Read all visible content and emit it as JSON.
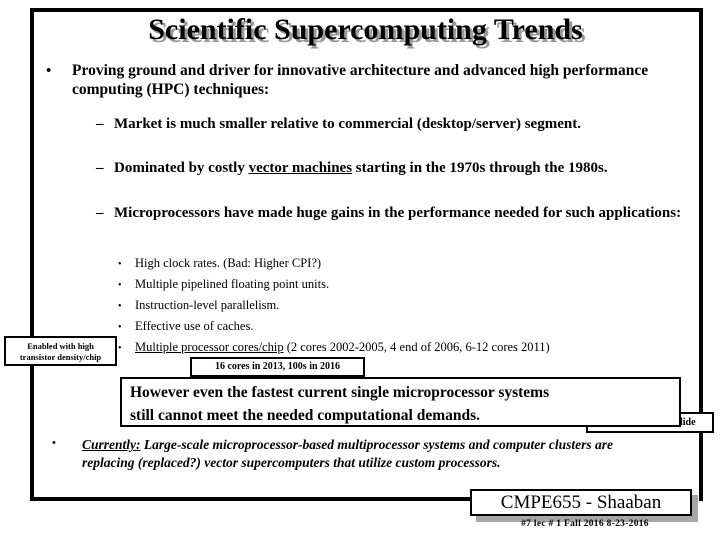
{
  "slide": {
    "title": "Scientific Supercomputing Trends",
    "bullets": {
      "level1": {
        "marker": "•",
        "text": "Proving ground and driver for innovative architecture and advanced high performance computing (HPC) techniques:"
      },
      "level2": [
        {
          "marker": "–",
          "text": "Market is much smaller relative to commercial (desktop/server) segment."
        },
        {
          "marker": "–",
          "text_before": "Dominated by costly ",
          "underlined": "vector machines",
          "text_after": " starting in the 1970s through the 1980s."
        },
        {
          "marker": "–",
          "text": "Microprocessors have made huge gains in the performance needed for such applications:"
        }
      ],
      "level3": [
        {
          "marker": "•",
          "text": "High clock rates.     (Bad:  Higher CPI?)"
        },
        {
          "marker": "•",
          "text": "Multiple pipelined floating point units."
        },
        {
          "marker": "•",
          "text": "Instruction-level parallelism."
        },
        {
          "marker": "•",
          "text": "Effective use of caches."
        },
        {
          "marker": "•",
          "underlined": "Multiple processor cores/chip",
          "text_after": "  (2 cores 2002-2005, 4 end of 2006, 6-12 cores 2011)"
        }
      ]
    },
    "notes": {
      "transistor_density": "Enabled with high transistor density/chip",
      "transistor_density_line1": "Enabled with high",
      "transistor_density_line2": "transistor density/chip",
      "cores_update": "16 cores in 2013, 100s in 2016",
      "last_slide": "As shown in last slide"
    },
    "callout": {
      "line1": "However even the fastest current single microprocessor systems",
      "line2": "still cannot meet the needed computational demands."
    },
    "final_bullet": {
      "marker": "•",
      "underlined": "Currently:",
      "text_after": "  Large-scale microprocessor-based  multiprocessor systems and computer clusters are replacing (replaced?) vector supercomputers that utilize custom processors."
    },
    "footer": {
      "course": "CMPE655 - Shaaban",
      "meta": "#7  lec # 1   Fall 2016   8-23-2016"
    },
    "colors": {
      "text": "#000000",
      "title_shadow": "#9a9a9a",
      "box_shadow": "#a6a6a6",
      "background": "#ffffff"
    }
  }
}
